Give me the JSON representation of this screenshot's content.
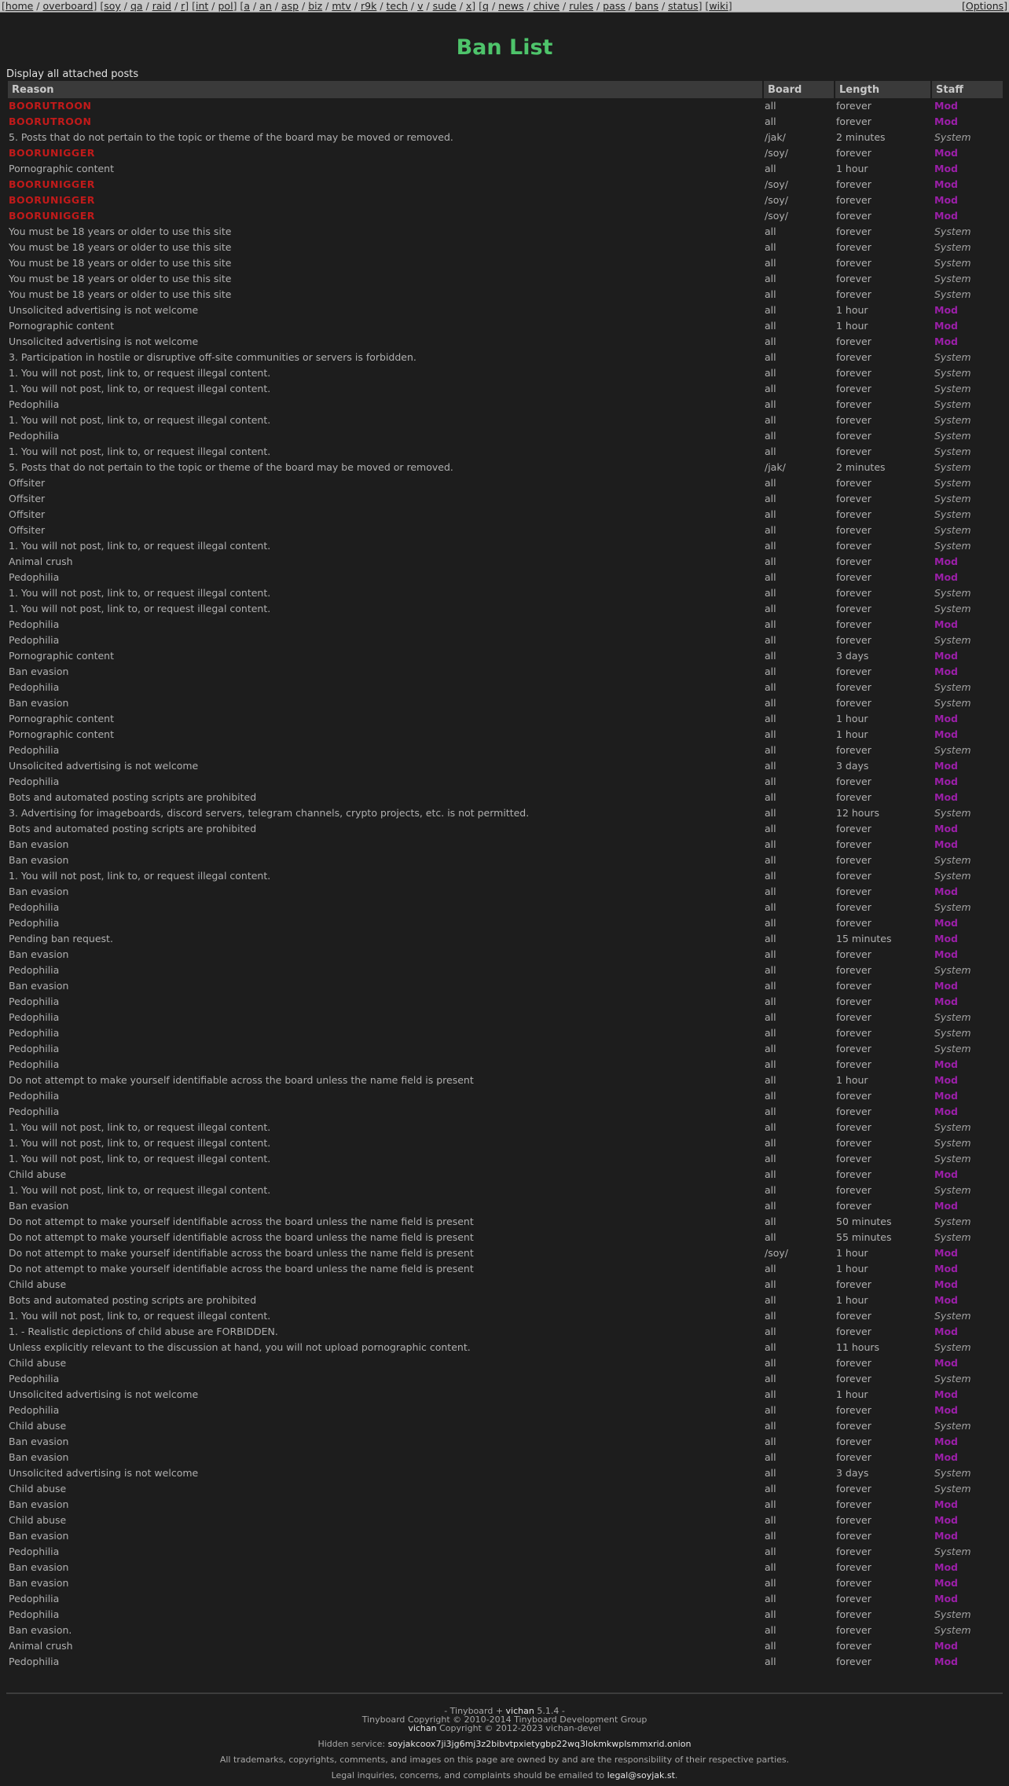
{
  "nav": {
    "groups": [
      [
        "home",
        "overboard"
      ],
      [
        "soy",
        "qa",
        "raid",
        "r"
      ],
      [
        "int",
        "pol"
      ],
      [
        "a",
        "an",
        "asp",
        "biz",
        "mtv",
        "r9k",
        "tech",
        "v",
        "sude",
        "x"
      ],
      [
        "q",
        "news",
        "chive",
        "rules",
        "pass",
        "bans",
        "status"
      ],
      [
        "wiki"
      ]
    ],
    "options_label": "[Options]"
  },
  "page": {
    "title": "Ban List",
    "show_attached": "Display all attached posts"
  },
  "table": {
    "headers": [
      "Reason",
      "Board",
      "Length",
      "Staff"
    ],
    "rows": [
      {
        "reason": "BOORUTROON",
        "board": "all",
        "length": "forever",
        "staff": "Mod",
        "big": true
      },
      {
        "reason": "BOORUTROON",
        "board": "all",
        "length": "forever",
        "staff": "Mod",
        "big": true
      },
      {
        "reason": "5. Posts that do not pertain to the topic or theme of the board may be moved or removed.",
        "board": "/jak/",
        "length": "2 minutes",
        "staff": "System"
      },
      {
        "reason": "BOORUNIGGER",
        "board": "/soy/",
        "length": "forever",
        "staff": "Mod",
        "big": true
      },
      {
        "reason": "Pornographic content",
        "board": "all",
        "length": "1 hour",
        "staff": "Mod"
      },
      {
        "reason": "BOORUNIGGER",
        "board": "/soy/",
        "length": "forever",
        "staff": "Mod",
        "big": true
      },
      {
        "reason": "BOORUNIGGER",
        "board": "/soy/",
        "length": "forever",
        "staff": "Mod",
        "big": true
      },
      {
        "reason": "BOORUNIGGER",
        "board": "/soy/",
        "length": "forever",
        "staff": "Mod",
        "big": true
      },
      {
        "reason": "You must be 18 years or older to use this site",
        "board": "all",
        "length": "forever",
        "staff": "System"
      },
      {
        "reason": "You must be 18 years or older to use this site",
        "board": "all",
        "length": "forever",
        "staff": "System"
      },
      {
        "reason": "You must be 18 years or older to use this site",
        "board": "all",
        "length": "forever",
        "staff": "System"
      },
      {
        "reason": "You must be 18 years or older to use this site",
        "board": "all",
        "length": "forever",
        "staff": "System"
      },
      {
        "reason": "You must be 18 years or older to use this site",
        "board": "all",
        "length": "forever",
        "staff": "System"
      },
      {
        "reason": "Unsolicited advertising is not welcome",
        "board": "all",
        "length": "1 hour",
        "staff": "Mod"
      },
      {
        "reason": "Pornographic content",
        "board": "all",
        "length": "1 hour",
        "staff": "Mod"
      },
      {
        "reason": "Unsolicited advertising is not welcome",
        "board": "all",
        "length": "forever",
        "staff": "Mod"
      },
      {
        "reason": "3. Participation in hostile or disruptive off-site communities or servers is forbidden.",
        "board": "all",
        "length": "forever",
        "staff": "System"
      },
      {
        "reason": "1. You will not post, link to, or request illegal content.",
        "board": "all",
        "length": "forever",
        "staff": "System"
      },
      {
        "reason": "1. You will not post, link to, or request illegal content.",
        "board": "all",
        "length": "forever",
        "staff": "System"
      },
      {
        "reason": "Pedophilia",
        "board": "all",
        "length": "forever",
        "staff": "System"
      },
      {
        "reason": "1. You will not post, link to, or request illegal content.",
        "board": "all",
        "length": "forever",
        "staff": "System"
      },
      {
        "reason": "Pedophilia",
        "board": "all",
        "length": "forever",
        "staff": "System"
      },
      {
        "reason": "1. You will not post, link to, or request illegal content.",
        "board": "all",
        "length": "forever",
        "staff": "System"
      },
      {
        "reason": "5. Posts that do not pertain to the topic or theme of the board may be moved or removed.",
        "board": "/jak/",
        "length": "2 minutes",
        "staff": "System"
      },
      {
        "reason": "Offsiter",
        "board": "all",
        "length": "forever",
        "staff": "System"
      },
      {
        "reason": "Offsiter",
        "board": "all",
        "length": "forever",
        "staff": "System"
      },
      {
        "reason": "Offsiter",
        "board": "all",
        "length": "forever",
        "staff": "System"
      },
      {
        "reason": "Offsiter",
        "board": "all",
        "length": "forever",
        "staff": "System"
      },
      {
        "reason": "1. You will not post, link to, or request illegal content.",
        "board": "all",
        "length": "forever",
        "staff": "System"
      },
      {
        "reason": "Animal crush",
        "board": "all",
        "length": "forever",
        "staff": "Mod"
      },
      {
        "reason": "Pedophilia",
        "board": "all",
        "length": "forever",
        "staff": "Mod"
      },
      {
        "reason": "1. You will not post, link to, or request illegal content.",
        "board": "all",
        "length": "forever",
        "staff": "System"
      },
      {
        "reason": "1. You will not post, link to, or request illegal content.",
        "board": "all",
        "length": "forever",
        "staff": "System"
      },
      {
        "reason": "Pedophilia",
        "board": "all",
        "length": "forever",
        "staff": "Mod"
      },
      {
        "reason": "Pedophilia",
        "board": "all",
        "length": "forever",
        "staff": "System"
      },
      {
        "reason": "Pornographic content",
        "board": "all",
        "length": "3 days",
        "staff": "Mod"
      },
      {
        "reason": "Ban evasion",
        "board": "all",
        "length": "forever",
        "staff": "Mod"
      },
      {
        "reason": "Pedophilia",
        "board": "all",
        "length": "forever",
        "staff": "System"
      },
      {
        "reason": "Ban evasion",
        "board": "all",
        "length": "forever",
        "staff": "System"
      },
      {
        "reason": "Pornographic content",
        "board": "all",
        "length": "1 hour",
        "staff": "Mod"
      },
      {
        "reason": "Pornographic content",
        "board": "all",
        "length": "1 hour",
        "staff": "Mod"
      },
      {
        "reason": "Pedophilia",
        "board": "all",
        "length": "forever",
        "staff": "System"
      },
      {
        "reason": "Unsolicited advertising is not welcome",
        "board": "all",
        "length": "3 days",
        "staff": "Mod"
      },
      {
        "reason": "Pedophilia",
        "board": "all",
        "length": "forever",
        "staff": "Mod"
      },
      {
        "reason": "Bots and automated posting scripts are prohibited",
        "board": "all",
        "length": "forever",
        "staff": "Mod"
      },
      {
        "reason": "3. Advertising for imageboards, discord servers, telegram channels, crypto projects, etc. is not permitted.",
        "board": "all",
        "length": "12 hours",
        "staff": "System"
      },
      {
        "reason": "Bots and automated posting scripts are prohibited",
        "board": "all",
        "length": "forever",
        "staff": "Mod"
      },
      {
        "reason": "Ban evasion",
        "board": "all",
        "length": "forever",
        "staff": "Mod"
      },
      {
        "reason": "Ban evasion",
        "board": "all",
        "length": "forever",
        "staff": "System"
      },
      {
        "reason": "1. You will not post, link to, or request illegal content.",
        "board": "all",
        "length": "forever",
        "staff": "System"
      },
      {
        "reason": "Ban evasion",
        "board": "all",
        "length": "forever",
        "staff": "Mod"
      },
      {
        "reason": "Pedophilia",
        "board": "all",
        "length": "forever",
        "staff": "System"
      },
      {
        "reason": "Pedophilia",
        "board": "all",
        "length": "forever",
        "staff": "Mod"
      },
      {
        "reason": "Pending ban request.",
        "board": "all",
        "length": "15 minutes",
        "staff": "Mod"
      },
      {
        "reason": "Ban evasion",
        "board": "all",
        "length": "forever",
        "staff": "Mod"
      },
      {
        "reason": "Pedophilia",
        "board": "all",
        "length": "forever",
        "staff": "System"
      },
      {
        "reason": "Ban evasion",
        "board": "all",
        "length": "forever",
        "staff": "Mod"
      },
      {
        "reason": "Pedophilia",
        "board": "all",
        "length": "forever",
        "staff": "Mod"
      },
      {
        "reason": "Pedophilia",
        "board": "all",
        "length": "forever",
        "staff": "System"
      },
      {
        "reason": "Pedophilia",
        "board": "all",
        "length": "forever",
        "staff": "System"
      },
      {
        "reason": "Pedophilia",
        "board": "all",
        "length": "forever",
        "staff": "System"
      },
      {
        "reason": "Pedophilia",
        "board": "all",
        "length": "forever",
        "staff": "Mod"
      },
      {
        "reason": "Do not attempt to make yourself identifiable across the board unless the name field is present",
        "board": "all",
        "length": "1 hour",
        "staff": "Mod"
      },
      {
        "reason": "Pedophilia",
        "board": "all",
        "length": "forever",
        "staff": "Mod"
      },
      {
        "reason": "Pedophilia",
        "board": "all",
        "length": "forever",
        "staff": "Mod"
      },
      {
        "reason": "1. You will not post, link to, or request illegal content.",
        "board": "all",
        "length": "forever",
        "staff": "System"
      },
      {
        "reason": "1. You will not post, link to, or request illegal content.",
        "board": "all",
        "length": "forever",
        "staff": "System"
      },
      {
        "reason": "1. You will not post, link to, or request illegal content.",
        "board": "all",
        "length": "forever",
        "staff": "System"
      },
      {
        "reason": "Child abuse",
        "board": "all",
        "length": "forever",
        "staff": "Mod"
      },
      {
        "reason": "1. You will not post, link to, or request illegal content.",
        "board": "all",
        "length": "forever",
        "staff": "System"
      },
      {
        "reason": "Ban evasion",
        "board": "all",
        "length": "forever",
        "staff": "Mod"
      },
      {
        "reason": "Do not attempt to make yourself identifiable across the board unless the name field is present",
        "board": "all",
        "length": "50 minutes",
        "staff": "System"
      },
      {
        "reason": "Do not attempt to make yourself identifiable across the board unless the name field is present",
        "board": "all",
        "length": "55 minutes",
        "staff": "System"
      },
      {
        "reason": "Do not attempt to make yourself identifiable across the board unless the name field is present",
        "board": "/soy/",
        "length": "1 hour",
        "staff": "Mod"
      },
      {
        "reason": "Do not attempt to make yourself identifiable across the board unless the name field is present",
        "board": "all",
        "length": "1 hour",
        "staff": "Mod"
      },
      {
        "reason": "Child abuse",
        "board": "all",
        "length": "forever",
        "staff": "Mod"
      },
      {
        "reason": "Bots and automated posting scripts are prohibited",
        "board": "all",
        "length": "1 hour",
        "staff": "Mod"
      },
      {
        "reason": "1. You will not post, link to, or request illegal content.",
        "board": "all",
        "length": "forever",
        "staff": "System"
      },
      {
        "reason": "1. - Realistic depictions of child abuse are FORBIDDEN.",
        "board": "all",
        "length": "forever",
        "staff": "Mod"
      },
      {
        "reason": "Unless explicitly relevant to the discussion at hand, you will not upload pornographic content.",
        "board": "all",
        "length": "11 hours",
        "staff": "System"
      },
      {
        "reason": "Child abuse",
        "board": "all",
        "length": "forever",
        "staff": "Mod"
      },
      {
        "reason": "Pedophilia",
        "board": "all",
        "length": "forever",
        "staff": "System"
      },
      {
        "reason": "Unsolicited advertising is not welcome",
        "board": "all",
        "length": "1 hour",
        "staff": "Mod"
      },
      {
        "reason": "Pedophilia",
        "board": "all",
        "length": "forever",
        "staff": "Mod"
      },
      {
        "reason": "Child abuse",
        "board": "all",
        "length": "forever",
        "staff": "System"
      },
      {
        "reason": "Ban evasion",
        "board": "all",
        "length": "forever",
        "staff": "Mod"
      },
      {
        "reason": "Ban evasion",
        "board": "all",
        "length": "forever",
        "staff": "Mod"
      },
      {
        "reason": "Unsolicited advertising is not welcome",
        "board": "all",
        "length": "3 days",
        "staff": "System"
      },
      {
        "reason": "Child abuse",
        "board": "all",
        "length": "forever",
        "staff": "System"
      },
      {
        "reason": "Ban evasion",
        "board": "all",
        "length": "forever",
        "staff": "Mod"
      },
      {
        "reason": "Child abuse",
        "board": "all",
        "length": "forever",
        "staff": "Mod"
      },
      {
        "reason": "Ban evasion",
        "board": "all",
        "length": "forever",
        "staff": "Mod"
      },
      {
        "reason": "Pedophilia",
        "board": "all",
        "length": "forever",
        "staff": "System"
      },
      {
        "reason": "Ban evasion",
        "board": "all",
        "length": "forever",
        "staff": "Mod"
      },
      {
        "reason": "Ban evasion",
        "board": "all",
        "length": "forever",
        "staff": "Mod"
      },
      {
        "reason": "Pedophilia",
        "board": "all",
        "length": "forever",
        "staff": "Mod"
      },
      {
        "reason": "Pedophilia",
        "board": "all",
        "length": "forever",
        "staff": "System"
      },
      {
        "reason": "Ban evasion.",
        "board": "all",
        "length": "forever",
        "staff": "System"
      },
      {
        "reason": "Animal crush",
        "board": "all",
        "length": "forever",
        "staff": "Mod"
      },
      {
        "reason": "Pedophilia",
        "board": "all",
        "length": "forever",
        "staff": "Mod"
      }
    ]
  },
  "footer": {
    "line1_prefix": "- Tinyboard + ",
    "line1_vichan": "vichan",
    "line1_suffix": " 5.1.4 -",
    "line2": "Tinyboard Copyright © 2010-2014 Tinyboard Development Group",
    "line3_vichan": "vichan",
    "line3_suffix": " Copyright © 2012-2023 vichan-devel",
    "hidden_prefix": "Hidden service: ",
    "hidden_addr": "soyjakcoox7ji3jg6mj3z2bibvtpxietygbp22wq3lokmkwplsmmxrid.onion",
    "trademark": "All trademarks, copyrights, comments, and images on this page are owned by and are the responsibility of their respective parties.",
    "legal_prefix": "Legal inquiries, concerns, and complaints should be emailed to ",
    "legal_email": "legal@soyjak.st",
    "legal_suffix": "."
  }
}
